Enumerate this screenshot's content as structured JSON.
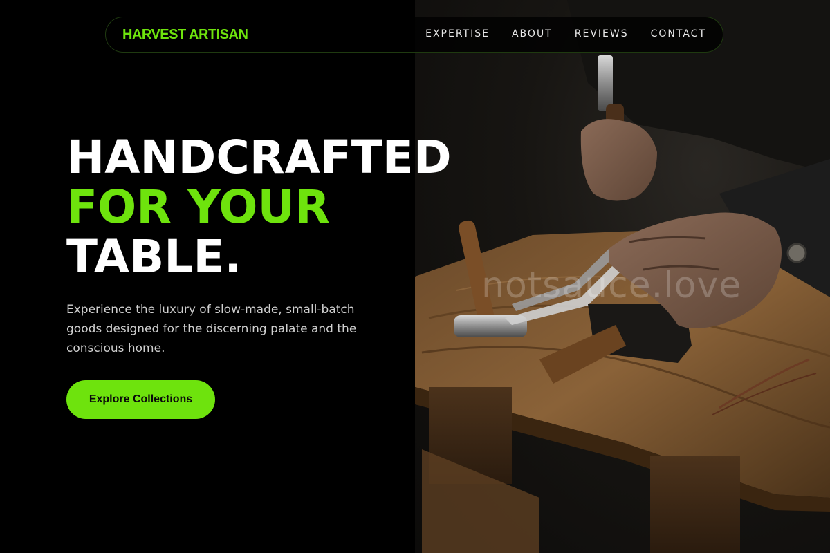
{
  "nav": {
    "brand": "HARVEST ARTISAN",
    "links": [
      {
        "label": "EXPERTISE"
      },
      {
        "label": "ABOUT"
      },
      {
        "label": "REVIEWS"
      },
      {
        "label": "CONTACT"
      }
    ]
  },
  "hero": {
    "title_line1": "HANDCRAFTED",
    "title_line2": "FOR YOUR",
    "title_line3": "TABLE.",
    "subtitle": "Experience the luxury of slow-made, small-batch goods designed for the discerning palate and the conscious home.",
    "cta_label": "Explore Collections"
  },
  "photo": {
    "watermark": "notsauce.love"
  },
  "colors": {
    "accent": "#6ee30d",
    "background": "#000000",
    "text": "#ffffff",
    "muted_text": "#cfcfcf"
  }
}
